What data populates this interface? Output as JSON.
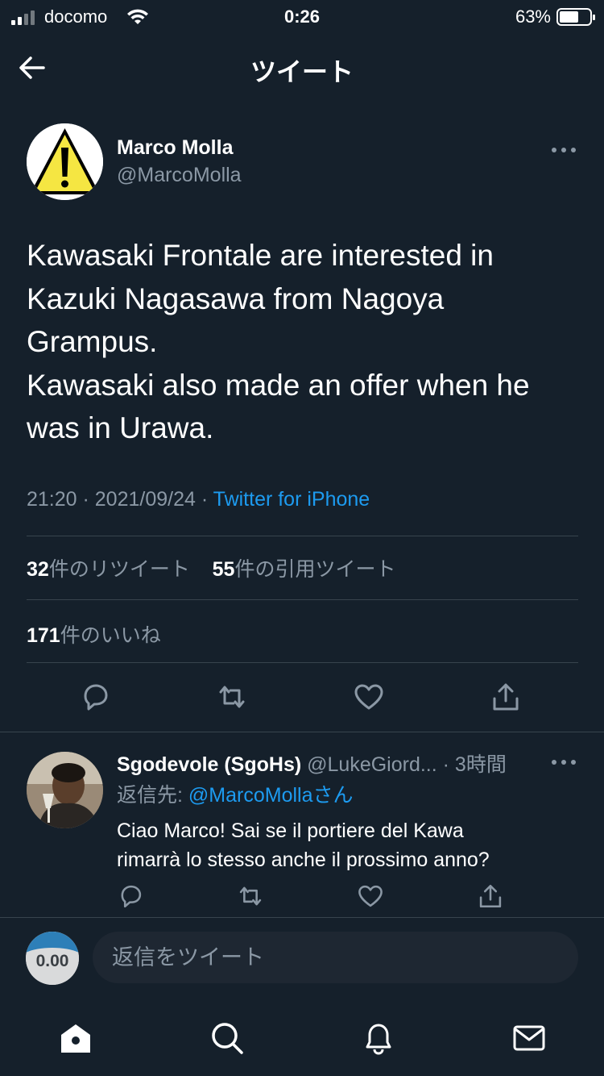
{
  "status_bar": {
    "carrier": "docomo",
    "time": "0:26",
    "battery_percent": "63%",
    "battery_level": 0.63,
    "icons": [
      "signal-icon",
      "wifi-icon",
      "battery-icon"
    ]
  },
  "header": {
    "title": "ツイート",
    "back_icon": "arrow-left-icon"
  },
  "tweet": {
    "author_name": "Marco Molla",
    "author_handle": "@MarcoMolla",
    "text": "Kawasaki Frontale are interested in\nKazuki Nagasawa from Nagoya\nGrampus.\nKawasaki also made an offer when he\nwas in Urawa.",
    "time": "21:20",
    "date": "2021/09/24",
    "separator": " · ",
    "source": "Twitter for iPhone",
    "retweets_count": "32",
    "retweets_label": "件のリツイート",
    "quotes_count": "55",
    "quotes_label": "件の引用ツイート",
    "likes_count": "171",
    "likes_label": "件のいいね"
  },
  "reply": {
    "author_name": "Sgodevole (SgoHs)",
    "author_handle": "@LukeGiord...",
    "time": "· 3時間",
    "reply_to_label": "返信先: ",
    "reply_to_mention": "@MarcoMollaさん",
    "text": "Ciao Marco! Sai se il portiere del Kawa\nrimarrà lo stesso anche il prossimo anno?"
  },
  "compose": {
    "placeholder": "返信をツイート",
    "avatar_text": "0.00"
  },
  "colors": {
    "background": "#15202b",
    "accent": "#1d9bf0",
    "secondary_text": "#8b98a5",
    "divider": "#38444d"
  },
  "tabs": [
    "home-icon",
    "search-icon",
    "notifications-icon",
    "messages-icon"
  ]
}
